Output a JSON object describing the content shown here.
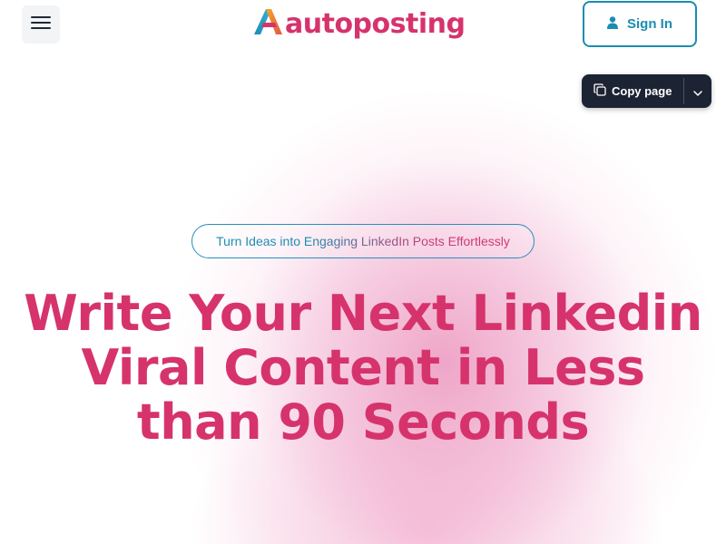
{
  "header": {
    "menu_icon": "hamburger-menu-icon",
    "logo": {
      "mark_icon": "autoposting-a-logo-icon",
      "text": "autoposting"
    },
    "sign_in": {
      "icon": "user-icon",
      "label": "Sign In"
    }
  },
  "copy_page": {
    "icon": "copy-icon",
    "label": "Copy page",
    "dropdown_icon": "chevron-down-icon"
  },
  "hero": {
    "tagline": "Turn Ideas into Engaging LinkedIn Posts Effortlessly",
    "headline_lines": [
      "Write Your Next Linkedin",
      "Viral Content in Less",
      "than 90 Seconds"
    ]
  },
  "colors": {
    "brand_pink": "#d6336c",
    "brand_blue": "#1a8db3",
    "dark_button": "#1c2333"
  }
}
